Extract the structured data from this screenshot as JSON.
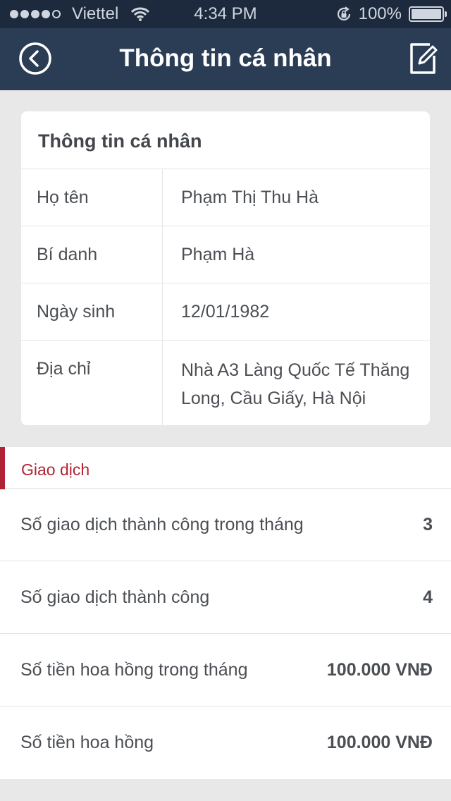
{
  "status_bar": {
    "carrier": "Viettel",
    "time": "4:34 PM",
    "battery": "100%",
    "signal_bars": 4,
    "icons": [
      "wifi-icon",
      "rotation-lock-icon",
      "battery-icon"
    ]
  },
  "nav": {
    "title": "Thông tin cá nhân",
    "back_icon": "back-circle-icon",
    "edit_icon": "edit-icon"
  },
  "profile_card": {
    "title": "Thông tin cá nhân",
    "rows": [
      {
        "label": "Họ tên",
        "value": "Phạm Thị Thu Hà"
      },
      {
        "label": "Bí danh",
        "value": "Phạm Hà"
      },
      {
        "label": "Ngày sinh",
        "value": "12/01/1982"
      },
      {
        "label": "Địa chỉ",
        "value": "Nhà A3 Làng Quốc Tế Thăng Long, Cầu Giấy, Hà Nội"
      }
    ]
  },
  "transactions": {
    "header": "Giao dịch",
    "rows": [
      {
        "label": "Số giao dịch thành công trong tháng",
        "value": "3"
      },
      {
        "label": "Số giao dịch thành công",
        "value": "4"
      },
      {
        "label": "Số tiền hoa hồng trong tháng",
        "value": "100.000 VNĐ"
      },
      {
        "label": "Số tiền hoa hồng",
        "value": "100.000 VNĐ"
      }
    ]
  },
  "colors": {
    "nav_bg": "#2b3c55",
    "status_bg": "#1d2a3d",
    "page_bg": "#e8e8e8",
    "accent": "#b02335"
  }
}
